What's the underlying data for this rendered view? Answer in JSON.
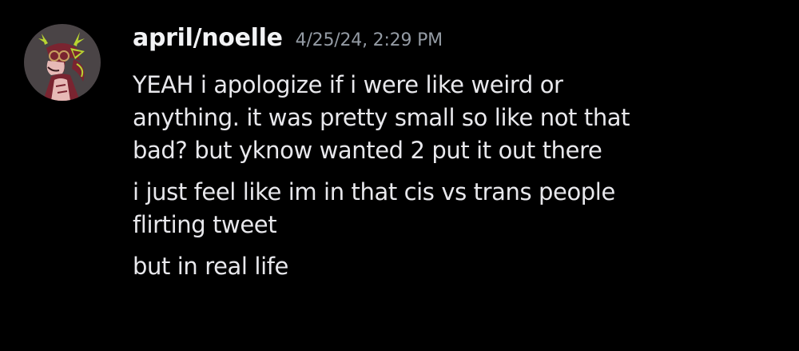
{
  "message": {
    "author": "april/noelle",
    "timestamp": "4/25/24, 2:29 PM",
    "avatar_icon": "deer-character-avatar-icon",
    "paragraphs": [
      {
        "lines": [
          "YEAH i apologize if i were like weird or",
          "anything. it was pretty small so like not that",
          "bad? but yknow wanted 2 put it out there"
        ]
      },
      {
        "lines": [
          "i just feel like im in that cis vs trans people",
          "flirting tweet"
        ]
      },
      {
        "lines": [
          "but in real life"
        ]
      }
    ]
  },
  "colors": {
    "background": "#000000",
    "username": "#f2f3f5",
    "timestamp": "#949ba4",
    "message_text": "#e8e8ec",
    "avatar_bg": "#4a4446",
    "avatar_accent": "#b9d531",
    "avatar_fur": "#7a2430"
  }
}
